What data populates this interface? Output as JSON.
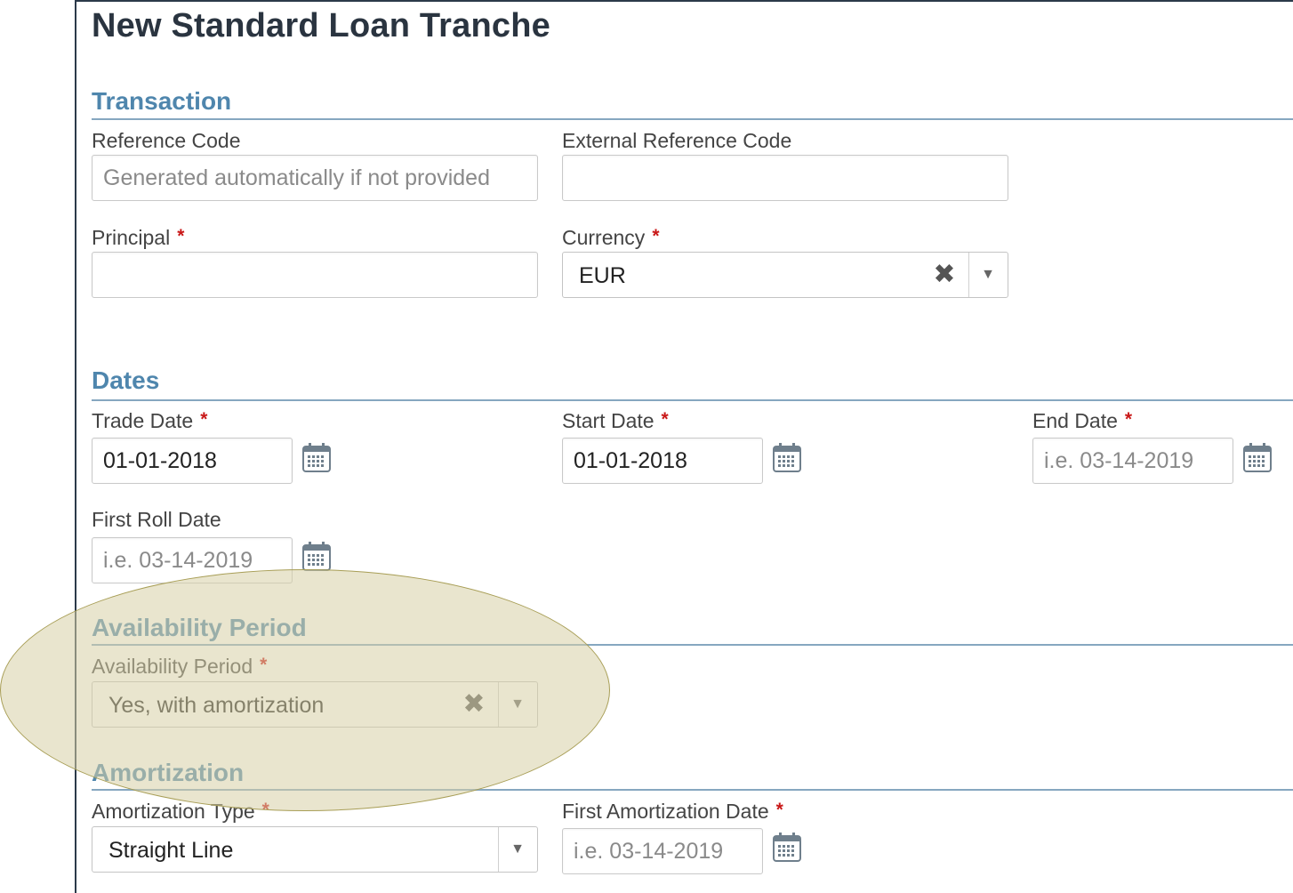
{
  "title": "New Standard Loan Tranche",
  "sections": {
    "transaction": "Transaction",
    "dates": "Dates",
    "availability": "Availability Period",
    "amortization": "Amortization"
  },
  "fields": {
    "reference_code": {
      "label": "Reference Code",
      "value": "",
      "placeholder": "Generated automatically if not provided"
    },
    "external_reference_code": {
      "label": "External Reference Code",
      "value": "",
      "placeholder": ""
    },
    "principal": {
      "label": "Principal",
      "required": "*",
      "value": "",
      "placeholder": ""
    },
    "currency": {
      "label": "Currency",
      "required": "*",
      "value": "EUR"
    },
    "trade_date": {
      "label": "Trade Date",
      "required": "*",
      "value": "01-01-2018",
      "placeholder": "i.e. 03-14-2019"
    },
    "start_date": {
      "label": "Start Date",
      "required": "*",
      "value": "01-01-2018",
      "placeholder": "i.e. 03-14-2019"
    },
    "end_date": {
      "label": "End Date",
      "required": "*",
      "value": "",
      "placeholder": "i.e. 03-14-2019"
    },
    "first_roll_date": {
      "label": "First Roll Date",
      "value": "",
      "placeholder": "i.e. 03-14-2019"
    },
    "availability_period": {
      "label": "Availability Period",
      "required": "*",
      "value": "Yes, with amortization"
    },
    "amortization_type": {
      "label": "Amortization Type",
      "required": "*",
      "value": "Straight Line"
    },
    "first_amortization_date": {
      "label": "First Amortization Date",
      "required": "*",
      "value": "",
      "placeholder": "i.e. 03-14-2019"
    }
  },
  "icons": {
    "clear": "close-icon",
    "dropdown": "chevron-down-icon",
    "calendar": "calendar-icon"
  },
  "colors": {
    "section_title": "#4f86ad",
    "required_marker": "#c91818",
    "highlight": "#d7cfa5"
  }
}
